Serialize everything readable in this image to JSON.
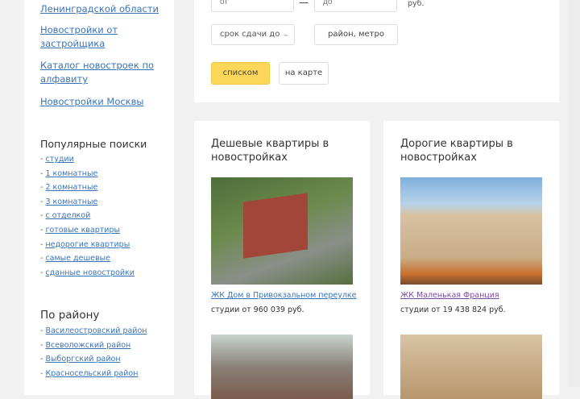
{
  "sidebar": {
    "links": [
      "Ленинградской области",
      "Новостройки от застройщика",
      "Каталог новостроек по алфавиту",
      "Новостройки Москвы"
    ],
    "popular_title": "Популярные поиски",
    "popular": [
      "студии",
      "1 комнатные",
      "2 комнатные",
      "3 комнатные",
      "с отделкой",
      "готовые квартиры",
      "недорогие квартиры",
      "самые дешевые",
      "сданные новостройки"
    ],
    "district_title": "По району",
    "districts": [
      "Василеостровский район",
      "Всеволожский район",
      "Выборгский район",
      "Красносельский район"
    ]
  },
  "filter": {
    "from_placeholder": "от",
    "to_placeholder": "до",
    "dash": "—",
    "currency": "руб.",
    "deadline": "срок сдачи до",
    "district": "район, метро",
    "list_btn": "списком",
    "map_btn": "на карте"
  },
  "cards": [
    {
      "title": "Дешевые квартиры в новостройках",
      "link": "ЖК Дом в Привокзальном переулке",
      "price": "студии от 960 039 руб."
    },
    {
      "title": "Дорогие квартиры в новостройках",
      "link": "ЖК Маленькая Франция",
      "price": "студии от 19 438 824 руб."
    }
  ]
}
